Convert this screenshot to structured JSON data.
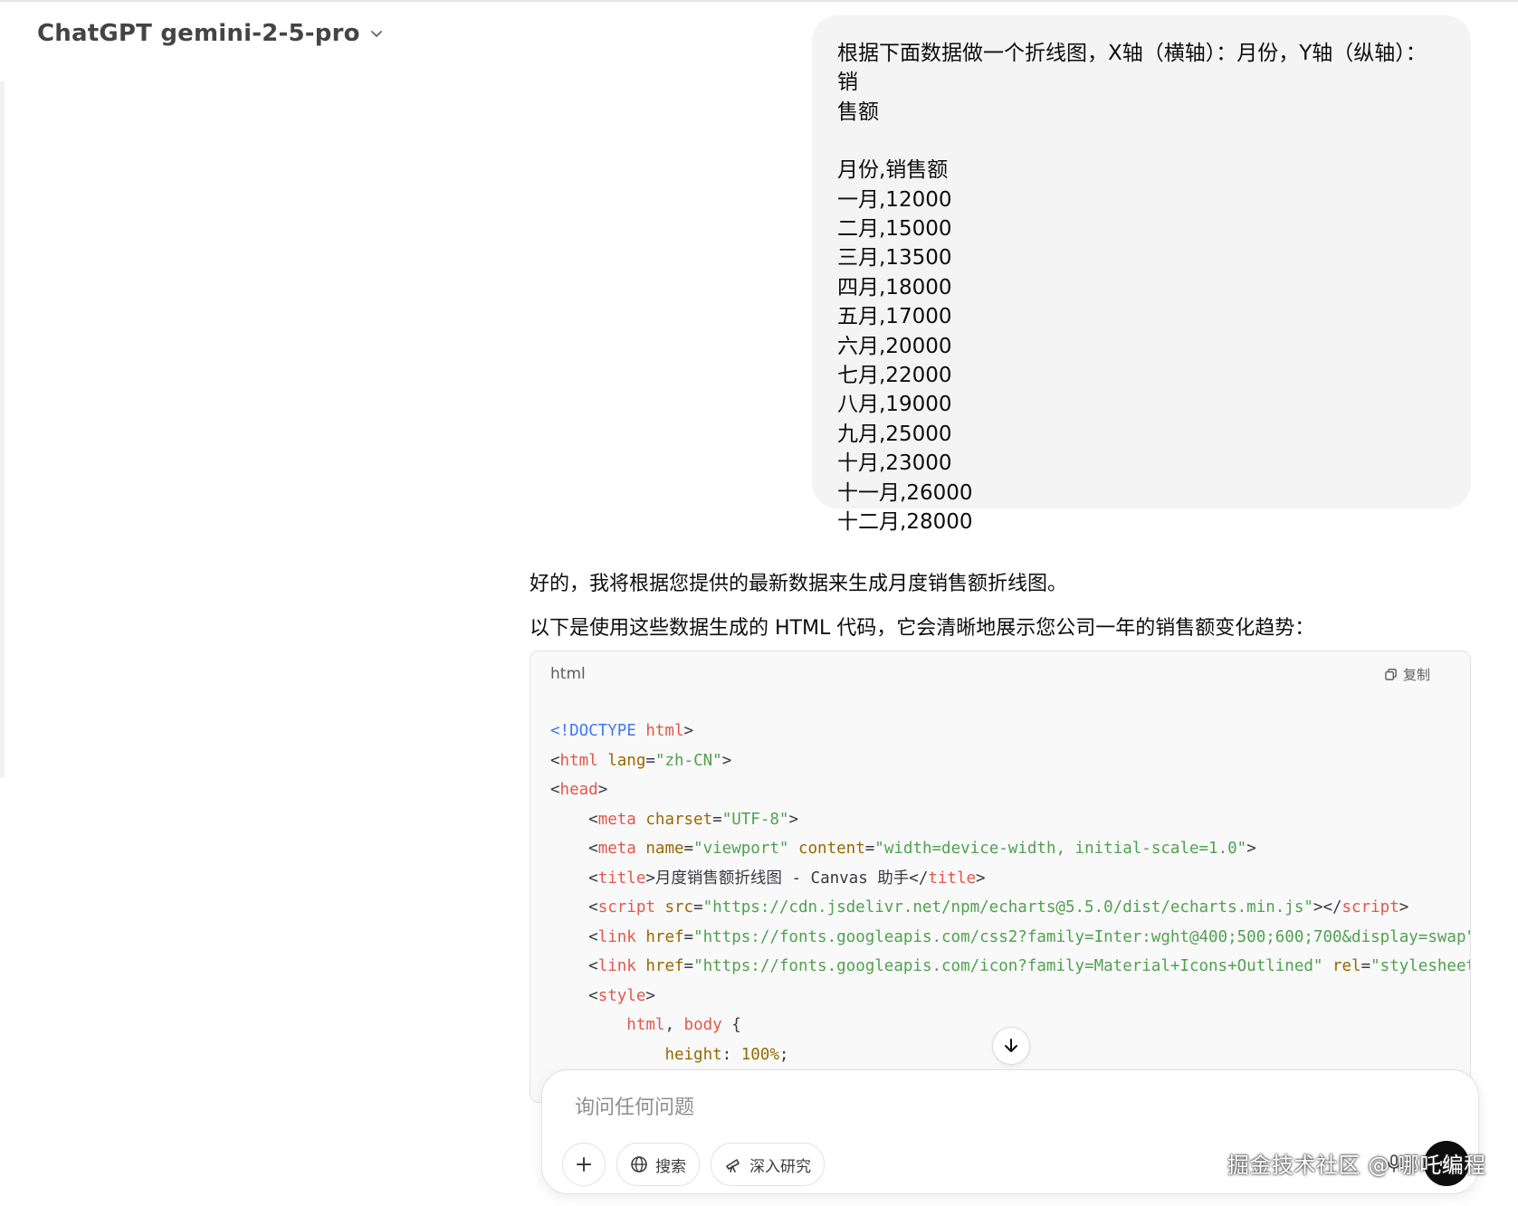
{
  "header": {
    "title": "ChatGPT gemini-2-5-pro"
  },
  "user_message": {
    "lines": [
      "根据下面数据做一个折线图，X轴（横轴）：月份，Y轴（纵轴）：销",
      "售额",
      "",
      "月份,销售额",
      "一月,12000",
      "二月,15000",
      "三月,13500",
      "四月,18000",
      "五月,17000",
      "六月,20000",
      "七月,22000",
      "八月,19000",
      "九月,25000",
      "十月,23000",
      "十一月,26000",
      "十二月,28000"
    ]
  },
  "assistant": {
    "p1": "好的，我将根据您提供的最新数据来生成月度销售额折线图。",
    "p2": "以下是使用这些数据生成的 HTML 代码，它会清晰地展示您公司一年的销售额变化趋势："
  },
  "code_block": {
    "language": "html",
    "copy_label": "复制",
    "lines": [
      [
        [
          "dt",
          "<!DOCTYPE "
        ],
        [
          "tag",
          "html"
        ],
        [
          "pun",
          ">"
        ]
      ],
      [
        [
          "pun",
          "<"
        ],
        [
          "tag",
          "html "
        ],
        [
          "attr",
          "lang"
        ],
        [
          "pun",
          "="
        ],
        [
          "str",
          "\"zh-CN\""
        ],
        [
          "pun",
          ">"
        ]
      ],
      [
        [
          "pun",
          "<"
        ],
        [
          "tag",
          "head"
        ],
        [
          "pun",
          ">"
        ]
      ],
      [
        [
          "pun",
          "    <"
        ],
        [
          "tag",
          "meta "
        ],
        [
          "attr",
          "charset"
        ],
        [
          "pun",
          "="
        ],
        [
          "str",
          "\"UTF-8\""
        ],
        [
          "pun",
          ">"
        ]
      ],
      [
        [
          "pun",
          "    <"
        ],
        [
          "tag",
          "meta "
        ],
        [
          "attr",
          "name"
        ],
        [
          "pun",
          "="
        ],
        [
          "str",
          "\"viewport\" "
        ],
        [
          "attr",
          "content"
        ],
        [
          "pun",
          "="
        ],
        [
          "str",
          "\"width=device-width, initial-scale=1.0\""
        ],
        [
          "pun",
          ">"
        ]
      ],
      [
        [
          "pun",
          "    <"
        ],
        [
          "tag",
          "title"
        ],
        [
          "pun",
          ">"
        ],
        [
          "txt",
          "月度销售额折线图 - Canvas 助手"
        ],
        [
          "pun",
          "</"
        ],
        [
          "tag",
          "title"
        ],
        [
          "pun",
          ">"
        ]
      ],
      [
        [
          "pun",
          "    <"
        ],
        [
          "tag",
          "script "
        ],
        [
          "attr",
          "src"
        ],
        [
          "pun",
          "="
        ],
        [
          "str",
          "\"https://cdn.jsdelivr.net/npm/echarts@5.5.0/dist/echarts.min.js\""
        ],
        [
          "pun",
          "></"
        ],
        [
          "tag",
          "script"
        ],
        [
          "pun",
          ">"
        ]
      ],
      [
        [
          "pun",
          "    <"
        ],
        [
          "tag",
          "link "
        ],
        [
          "attr",
          "href"
        ],
        [
          "pun",
          "="
        ],
        [
          "str",
          "\"https://fonts.googleapis.com/css2?family=Inter:wght@400;500;600;700&display=swap\""
        ]
      ],
      [
        [
          "pun",
          "    <"
        ],
        [
          "tag",
          "link "
        ],
        [
          "attr",
          "href"
        ],
        [
          "pun",
          "="
        ],
        [
          "str",
          "\"https://fonts.googleapis.com/icon?family=Material+Icons+Outlined\" "
        ],
        [
          "attr",
          "rel"
        ],
        [
          "pun",
          "="
        ],
        [
          "str",
          "\"stylesheet\""
        ]
      ],
      [
        [
          "pun",
          "    <"
        ],
        [
          "tag",
          "style"
        ],
        [
          "pun",
          ">"
        ]
      ],
      [
        [
          "pun",
          "        "
        ],
        [
          "tag",
          "html"
        ],
        [
          "pun",
          ", "
        ],
        [
          "tag",
          "body"
        ],
        [
          "pun",
          " {"
        ]
      ],
      [
        [
          "pun",
          "            "
        ],
        [
          "attr",
          "height"
        ],
        [
          "pun",
          ": "
        ],
        [
          "num",
          "100%"
        ],
        [
          "pun",
          ";"
        ]
      ]
    ]
  },
  "composer": {
    "placeholder": "询问任何问题",
    "search_label": "搜索",
    "research_label": "深入研究"
  },
  "watermark": "掘金技术社区 @ 哪吒编程",
  "colors": {
    "bubble_bg": "#f4f4f4",
    "code_bg": "#f9f9f9",
    "tag": "#e45649",
    "attr": "#986801",
    "string": "#50a14f",
    "doctype": "#4078f2"
  }
}
